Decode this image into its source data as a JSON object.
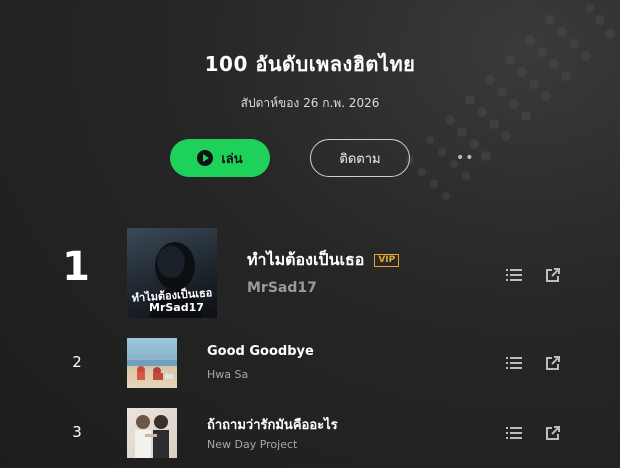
{
  "chart": {
    "title": "100 อันดับเพลงฮิตไทย",
    "subtitle": "สัปดาห์ของ 26 ก.พ. 2026"
  },
  "actions": {
    "play_label": "เล่น",
    "follow_label": "ติดตาม",
    "more_icon": "more-dots-icon"
  },
  "tracks": [
    {
      "rank": "1",
      "title": "ทำไมต้องเป็นเธอ",
      "badge": "VIP",
      "artist": "MrSad17",
      "cover_text": "ทำไมต้องเป็นเธอ",
      "cover_artist": "MrSad17"
    },
    {
      "rank": "2",
      "title": "Good Goodbye",
      "artist": "Hwa Sa"
    },
    {
      "rank": "3",
      "title": "ถ้าถามว่ารักมันคืออะไร",
      "artist": "New Day Project"
    }
  ],
  "icons": {
    "list": "playlist-add-icon",
    "share": "share-external-icon"
  },
  "colors": {
    "accent": "#1ed15a",
    "vip": "#e4a92c",
    "background": "#262626"
  }
}
